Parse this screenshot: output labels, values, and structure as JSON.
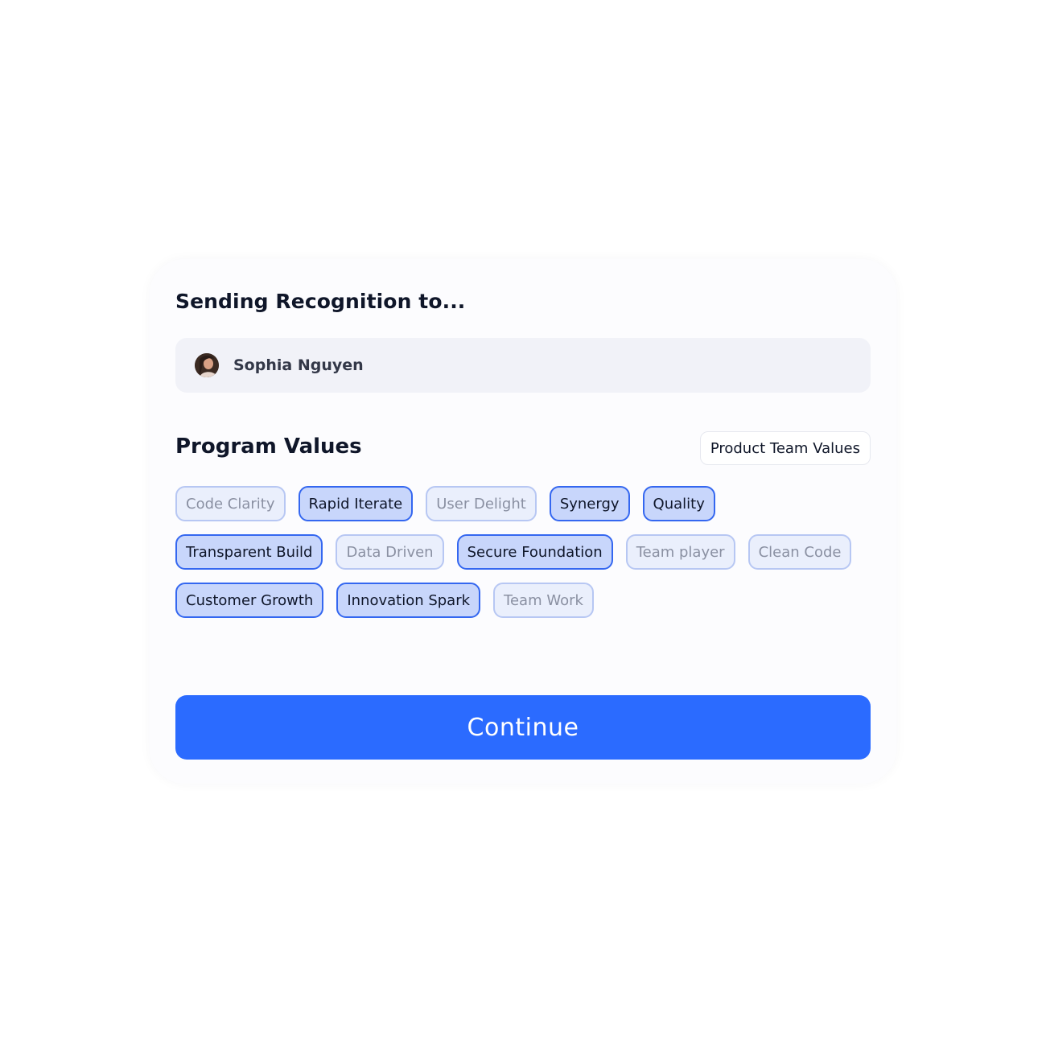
{
  "header": {
    "title": "Sending Recognition to..."
  },
  "recipient": {
    "name": "Sophia Nguyen",
    "avatar_icon": "user-avatar-photo"
  },
  "values_section": {
    "title": "Program Values",
    "group_selector": "Product Team Values",
    "chips": [
      {
        "label": "Code Clarity",
        "selected": false
      },
      {
        "label": "Rapid Iterate",
        "selected": true
      },
      {
        "label": "User Delight",
        "selected": false
      },
      {
        "label": "Synergy",
        "selected": true
      },
      {
        "label": "Quality",
        "selected": true
      },
      {
        "label": "Transparent Build",
        "selected": true
      },
      {
        "label": "Data Driven",
        "selected": false
      },
      {
        "label": "Secure Foundation",
        "selected": true
      },
      {
        "label": "Team player",
        "selected": false
      },
      {
        "label": "Clean Code",
        "selected": false
      },
      {
        "label": "Customer Growth",
        "selected": true
      },
      {
        "label": "Innovation Spark",
        "selected": true
      },
      {
        "label": "Team Work",
        "selected": false
      }
    ]
  },
  "actions": {
    "continue_label": "Continue"
  },
  "colors": {
    "accent": "#2b6bff",
    "chip_selected_bg": "#c8d6fb",
    "chip_selected_border": "#3467f0",
    "chip_unselected_bg": "#eaeffc",
    "chip_unselected_border": "#b7c7f3"
  }
}
